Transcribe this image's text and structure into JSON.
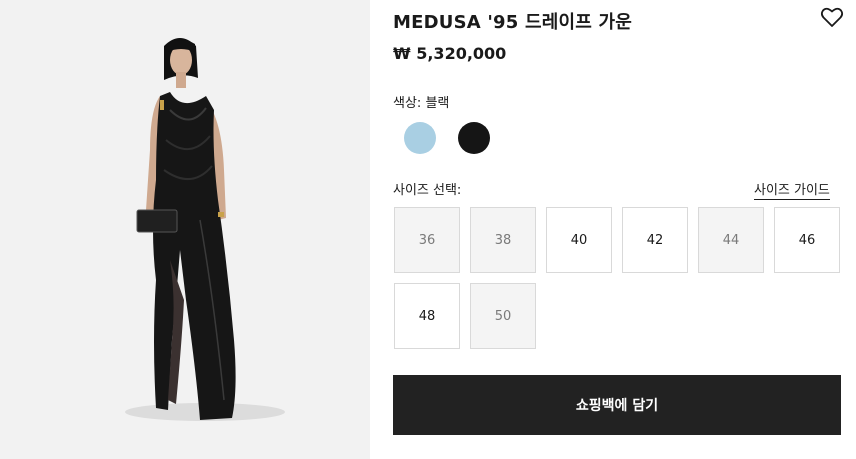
{
  "product": {
    "title": "MEDUSA '95 드레이프 가운",
    "price": "₩ 5,320,000",
    "image_icon": "model-wearing-black-gown"
  },
  "color": {
    "label": "색상:",
    "selected": "블랙",
    "swatches": [
      {
        "name": "light-blue",
        "hex": "#a9cfe3"
      },
      {
        "name": "black",
        "hex": "#151515"
      }
    ]
  },
  "sizes": {
    "label": "사이즈 선택:",
    "guide_label": "사이즈 가이드",
    "options": [
      {
        "value": "36",
        "available": false
      },
      {
        "value": "38",
        "available": false
      },
      {
        "value": "40",
        "available": true
      },
      {
        "value": "42",
        "available": true
      },
      {
        "value": "44",
        "available": false
      },
      {
        "value": "46",
        "available": true
      },
      {
        "value": "48",
        "available": true
      },
      {
        "value": "50",
        "available": false
      }
    ]
  },
  "actions": {
    "add_to_bag": "쇼핑백에 담기",
    "wishlist_icon": "heart-icon"
  }
}
